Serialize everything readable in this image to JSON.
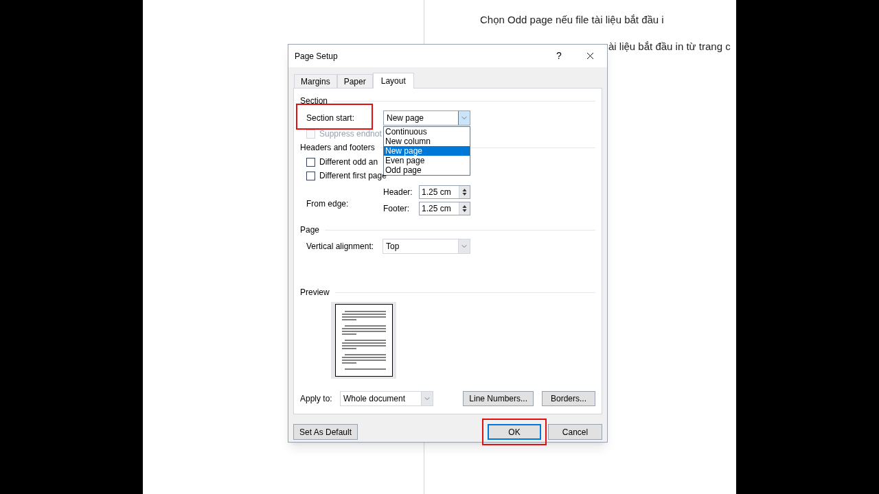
{
  "document": {
    "lines": [
      "Chọn Odd page nếu file tài liệu bắt đầu i",
      "ài liệu bắt đầu in từ trang c"
    ]
  },
  "dialog": {
    "title": "Page Setup",
    "help": "?",
    "tabs": [
      {
        "label": "Margins",
        "selected": false
      },
      {
        "label": "Paper",
        "selected": false
      },
      {
        "label": "Layout",
        "selected": true
      }
    ],
    "section": {
      "heading": "Section",
      "start_label": "Section start:",
      "start_value": "New page",
      "options": [
        {
          "label": "Continuous",
          "selected": false
        },
        {
          "label": "New column",
          "selected": false
        },
        {
          "label": "New page",
          "selected": true
        },
        {
          "label": "Even page",
          "selected": false
        },
        {
          "label": "Odd page",
          "selected": false
        }
      ],
      "suppress": {
        "label": "Suppress endnot",
        "checked": false,
        "disabled": true
      }
    },
    "headers_footers": {
      "heading": "Headers and footers",
      "checks": [
        {
          "label": "Different odd an",
          "checked": false,
          "disabled": false
        },
        {
          "label": "Different first page",
          "checked": false,
          "disabled": false
        }
      ],
      "from_edge": "From edge:",
      "spinners": [
        {
          "label": "Header:",
          "value": "1.25 cm"
        },
        {
          "label": "Footer:",
          "value": "1.25 cm"
        }
      ]
    },
    "page": {
      "heading": "Page",
      "valign_label": "Vertical alignment:",
      "valign_value": "Top"
    },
    "preview": {
      "heading": "Preview"
    },
    "apply_label": "Apply to:",
    "apply_value": "Whole document",
    "side_buttons": [
      "Line Numbers...",
      "Borders..."
    ],
    "footer_buttons": [
      {
        "label": "Set As Default",
        "default": false,
        "highlighted": false
      },
      {
        "label": "OK",
        "default": true,
        "highlighted": true
      },
      {
        "label": "Cancel",
        "default": false,
        "highlighted": false
      }
    ]
  }
}
